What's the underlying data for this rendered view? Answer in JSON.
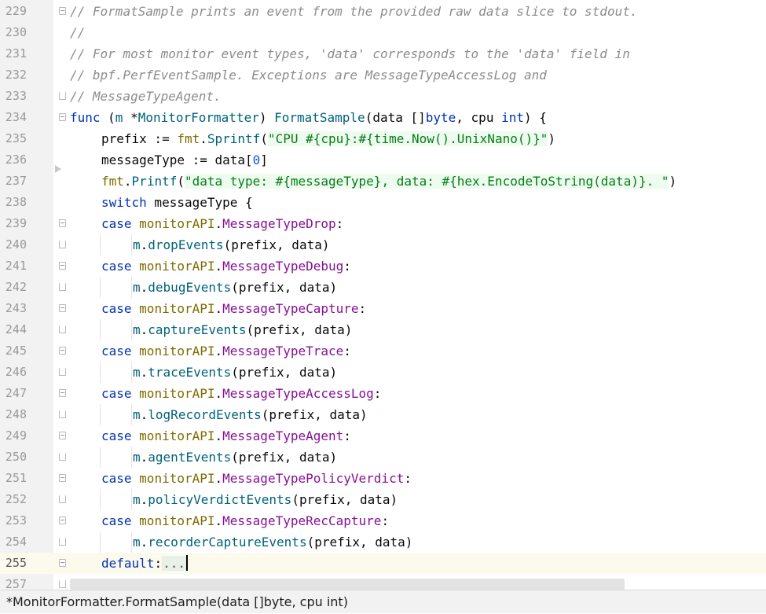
{
  "lines": [
    {
      "num": "229",
      "fold": "top",
      "tokens": [
        [
          "comment",
          "// "
        ],
        [
          "comment-b",
          "FormatSample"
        ],
        [
          "comment",
          " prints an event from the provided raw data slice to stdout."
        ]
      ]
    },
    {
      "num": "230",
      "tokens": [
        [
          "comment",
          "//"
        ]
      ]
    },
    {
      "num": "231",
      "tokens": [
        [
          "comment",
          "// For most monitor event types, 'data' corresponds to the 'data' field in"
        ]
      ]
    },
    {
      "num": "232",
      "tokens": [
        [
          "comment",
          "// bpf.PerfEventSample. Exceptions are MessageTypeAccessLog and"
        ]
      ]
    },
    {
      "num": "233",
      "fold": "end",
      "tokens": [
        [
          "comment",
          "// MessageTypeAgent."
        ]
      ]
    },
    {
      "num": "234",
      "fold": "top",
      "tokens": [
        [
          "kw",
          "func"
        ],
        [
          "plain",
          " ("
        ],
        [
          "param",
          "m"
        ],
        [
          "plain",
          " *"
        ],
        [
          "fn",
          "MonitorFormatter"
        ],
        [
          "plain",
          ") "
        ],
        [
          "fn",
          "FormatSample"
        ],
        [
          "plain",
          "(data []"
        ],
        [
          "kw",
          "byte"
        ],
        [
          "plain",
          ", cpu "
        ],
        [
          "kw",
          "int"
        ],
        [
          "plain",
          ") {"
        ]
      ]
    },
    {
      "num": "235",
      "indent": 1,
      "tokens": [
        [
          "plain",
          "prefix := "
        ],
        [
          "pkg",
          "fmt"
        ],
        [
          "plain",
          "."
        ],
        [
          "fn",
          "Sprintf"
        ],
        [
          "plain",
          "("
        ],
        [
          "str",
          "\"CPU #{cpu}:#{time.Now().UnixNano()}\""
        ],
        [
          "plain",
          ")"
        ]
      ]
    },
    {
      "num": "236",
      "indent": 1,
      "tokens": [
        [
          "plain",
          "messageType := data["
        ],
        [
          "num",
          "0"
        ],
        [
          "plain",
          "]"
        ]
      ]
    },
    {
      "num": "237",
      "indent": 1,
      "tokens": [
        [
          "pkg",
          "fmt"
        ],
        [
          "plain",
          "."
        ],
        [
          "fn",
          "Printf"
        ],
        [
          "plain",
          "("
        ],
        [
          "str",
          "\"data type: #{messageType}, data: #{hex.EncodeToString(data)}. \""
        ],
        [
          "plain",
          ")"
        ]
      ]
    },
    {
      "num": "238",
      "indent": 1,
      "tokens": [
        [
          "kw",
          "switch"
        ],
        [
          "plain",
          " messageType {"
        ]
      ]
    },
    {
      "num": "239",
      "indent": 1,
      "fold": "top",
      "tokens": [
        [
          "kw",
          "case"
        ],
        [
          "plain",
          " "
        ],
        [
          "pkg",
          "monitorAPI"
        ],
        [
          "plain",
          "."
        ],
        [
          "const",
          "MessageTypeDrop"
        ],
        [
          "plain",
          ":"
        ]
      ]
    },
    {
      "num": "240",
      "indent": 2,
      "fold": "end",
      "tokens": [
        [
          "param",
          "m"
        ],
        [
          "plain",
          "."
        ],
        [
          "fn",
          "dropEvents"
        ],
        [
          "plain",
          "(prefix, data)"
        ]
      ]
    },
    {
      "num": "241",
      "indent": 1,
      "fold": "top",
      "tokens": [
        [
          "kw",
          "case"
        ],
        [
          "plain",
          " "
        ],
        [
          "pkg",
          "monitorAPI"
        ],
        [
          "plain",
          "."
        ],
        [
          "const",
          "MessageTypeDebug"
        ],
        [
          "plain",
          ":"
        ]
      ]
    },
    {
      "num": "242",
      "indent": 2,
      "fold": "end",
      "tokens": [
        [
          "param",
          "m"
        ],
        [
          "plain",
          "."
        ],
        [
          "fn",
          "debugEvents"
        ],
        [
          "plain",
          "(prefix, data)"
        ]
      ]
    },
    {
      "num": "243",
      "indent": 1,
      "fold": "top",
      "tokens": [
        [
          "kw",
          "case"
        ],
        [
          "plain",
          " "
        ],
        [
          "pkg",
          "monitorAPI"
        ],
        [
          "plain",
          "."
        ],
        [
          "const",
          "MessageTypeCapture"
        ],
        [
          "plain",
          ":"
        ]
      ]
    },
    {
      "num": "244",
      "indent": 2,
      "fold": "end",
      "tokens": [
        [
          "param",
          "m"
        ],
        [
          "plain",
          "."
        ],
        [
          "fn",
          "captureEvents"
        ],
        [
          "plain",
          "(prefix, data)"
        ]
      ]
    },
    {
      "num": "245",
      "indent": 1,
      "fold": "top",
      "tokens": [
        [
          "kw",
          "case"
        ],
        [
          "plain",
          " "
        ],
        [
          "pkg",
          "monitorAPI"
        ],
        [
          "plain",
          "."
        ],
        [
          "const",
          "MessageTypeTrace"
        ],
        [
          "plain",
          ":"
        ]
      ]
    },
    {
      "num": "246",
      "indent": 2,
      "fold": "end",
      "tokens": [
        [
          "param",
          "m"
        ],
        [
          "plain",
          "."
        ],
        [
          "fn",
          "traceEvents"
        ],
        [
          "plain",
          "(prefix, data)"
        ]
      ]
    },
    {
      "num": "247",
      "indent": 1,
      "fold": "top",
      "tokens": [
        [
          "kw",
          "case"
        ],
        [
          "plain",
          " "
        ],
        [
          "pkg",
          "monitorAPI"
        ],
        [
          "plain",
          "."
        ],
        [
          "const",
          "MessageTypeAccessLog"
        ],
        [
          "plain",
          ":"
        ]
      ]
    },
    {
      "num": "248",
      "indent": 2,
      "fold": "end",
      "tokens": [
        [
          "param",
          "m"
        ],
        [
          "plain",
          "."
        ],
        [
          "fn",
          "logRecordEvents"
        ],
        [
          "plain",
          "(prefix, data)"
        ]
      ]
    },
    {
      "num": "249",
      "indent": 1,
      "fold": "top",
      "tokens": [
        [
          "kw",
          "case"
        ],
        [
          "plain",
          " "
        ],
        [
          "pkg",
          "monitorAPI"
        ],
        [
          "plain",
          "."
        ],
        [
          "const",
          "MessageTypeAgent"
        ],
        [
          "plain",
          ":"
        ]
      ]
    },
    {
      "num": "250",
      "indent": 2,
      "fold": "end",
      "tokens": [
        [
          "param",
          "m"
        ],
        [
          "plain",
          "."
        ],
        [
          "fn",
          "agentEvents"
        ],
        [
          "plain",
          "(prefix, data)"
        ]
      ]
    },
    {
      "num": "251",
      "indent": 1,
      "fold": "top",
      "tokens": [
        [
          "kw",
          "case"
        ],
        [
          "plain",
          " "
        ],
        [
          "pkg",
          "monitorAPI"
        ],
        [
          "plain",
          "."
        ],
        [
          "const",
          "MessageTypePolicyVerdict"
        ],
        [
          "plain",
          ":"
        ]
      ]
    },
    {
      "num": "252",
      "indent": 2,
      "fold": "end",
      "tokens": [
        [
          "param",
          "m"
        ],
        [
          "plain",
          "."
        ],
        [
          "fn",
          "policyVerdictEvents"
        ],
        [
          "plain",
          "(prefix, data)"
        ]
      ]
    },
    {
      "num": "253",
      "indent": 1,
      "fold": "top",
      "tokens": [
        [
          "kw",
          "case"
        ],
        [
          "plain",
          " "
        ],
        [
          "pkg",
          "monitorAPI"
        ],
        [
          "plain",
          "."
        ],
        [
          "const",
          "MessageTypeRecCapture"
        ],
        [
          "plain",
          ":"
        ]
      ]
    },
    {
      "num": "254",
      "indent": 2,
      "fold": "end",
      "tokens": [
        [
          "param",
          "m"
        ],
        [
          "plain",
          "."
        ],
        [
          "fn",
          "recorderCaptureEvents"
        ],
        [
          "plain",
          "(prefix, data)"
        ]
      ]
    },
    {
      "num": "255",
      "indent": 1,
      "current": true,
      "fold": "collapsed",
      "tokens": [
        [
          "kw",
          "default"
        ],
        [
          "plain",
          ":"
        ],
        [
          "dots",
          "..."
        ],
        [
          "caret",
          ""
        ]
      ]
    },
    {
      "num": "257",
      "indent": 1,
      "fold": "end",
      "tokens": [
        [
          "plain",
          "}"
        ]
      ]
    }
  ],
  "status_bar": {
    "breadcrumb": "*MonitorFormatter.FormatSample(data []byte, cpu int)"
  },
  "colors": {
    "keyword": "#0033b3",
    "comment": "#8c8c8c",
    "string": "#067d17",
    "function": "#00627a",
    "package": "#7d6b00",
    "constant": "#871094",
    "number": "#1750eb"
  }
}
